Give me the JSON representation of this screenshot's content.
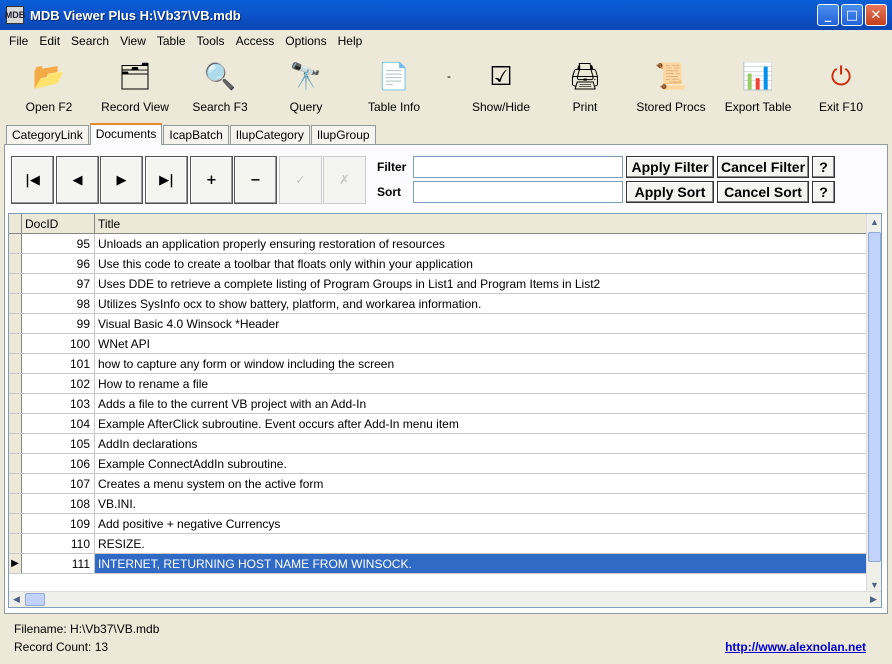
{
  "window": {
    "title": "MDB Viewer Plus H:\\Vb37\\VB.mdb",
    "app_icon_text": "MDB",
    "min_glyph": "_",
    "max_glyph": "□",
    "close_glyph": "✕"
  },
  "menu": [
    "File",
    "Edit",
    "Search",
    "View",
    "Table",
    "Tools",
    "Access",
    "Options",
    "Help"
  ],
  "toolbar": [
    {
      "label": "Open F2",
      "icon": "folder-icon",
      "glyph": "📂"
    },
    {
      "label": "Record View",
      "icon": "record-view-icon",
      "glyph": "🗂"
    },
    {
      "label": "Search F3",
      "icon": "magnifier-icon",
      "glyph": "🔍"
    },
    {
      "label": "Query",
      "icon": "binoculars-icon",
      "glyph": "🔭"
    },
    {
      "label": "Table Info",
      "icon": "table-info-icon",
      "glyph": "📄"
    },
    {
      "label": "-",
      "icon": "separator",
      "glyph": ""
    },
    {
      "label": "Show/Hide",
      "icon": "show-hide-icon",
      "glyph": "☑"
    },
    {
      "label": "Print",
      "icon": "printer-icon",
      "glyph": "🖨"
    },
    {
      "label": "Stored Procs",
      "icon": "stored-procs-icon",
      "glyph": "📜"
    },
    {
      "label": "Export Table",
      "icon": "export-table-icon",
      "glyph": "📊"
    },
    {
      "label": "Exit F10",
      "icon": "exit-icon",
      "glyph": "⏻"
    }
  ],
  "tabs": [
    {
      "label": "CategoryLink",
      "active": false
    },
    {
      "label": "Documents",
      "active": true
    },
    {
      "label": "IcapBatch",
      "active": false
    },
    {
      "label": "IlupCategory",
      "active": false
    },
    {
      "label": "IlupGroup",
      "active": false
    }
  ],
  "nav": {
    "first": "|◀",
    "prev": "◀",
    "next": "▶",
    "last": "▶|",
    "add": "+",
    "remove": "−",
    "confirm": "✓",
    "cancel": "✗"
  },
  "filter": {
    "filter_label": "Filter",
    "sort_label": "Sort",
    "filter_value": "",
    "sort_value": "",
    "apply_filter": "Apply Filter",
    "cancel_filter": "Cancel Filter",
    "apply_sort": "Apply Sort",
    "cancel_sort": "Cancel Sort",
    "help": "?"
  },
  "grid": {
    "columns": [
      "DocID",
      "Title"
    ],
    "current_row_marker": "▶",
    "rows": [
      {
        "id": "95",
        "title": "Unloads an application properly ensuring restoration of resources"
      },
      {
        "id": "96",
        "title": "Use this code to create a toolbar that floats only within your application"
      },
      {
        "id": "97",
        "title": "Uses DDE to retrieve a complete listing of Program Groups in List1 and Program Items in List2"
      },
      {
        "id": "98",
        "title": "Utilizes SysInfo ocx to show battery, platform, and workarea information."
      },
      {
        "id": "99",
        "title": "Visual Basic 4.0 Winsock *Header"
      },
      {
        "id": "100",
        "title": "WNet API"
      },
      {
        "id": "101",
        "title": "how to capture any form or window including the screen"
      },
      {
        "id": "102",
        "title": "How to rename a file"
      },
      {
        "id": "103",
        "title": "Adds a file to the current VB project with an Add-In"
      },
      {
        "id": "104",
        "title": "Example AfterClick subroutine. Event occurs after Add-In menu item"
      },
      {
        "id": "105",
        "title": "AddIn declarations"
      },
      {
        "id": "106",
        "title": "Example ConnectAddIn subroutine."
      },
      {
        "id": "107",
        "title": "Creates a menu system on the active form"
      },
      {
        "id": "108",
        "title": "VB.INI."
      },
      {
        "id": "109",
        "title": "Add positive + negative Currencys"
      },
      {
        "id": "110",
        "title": "RESIZE."
      },
      {
        "id": "111",
        "title": "INTERNET, RETURNING HOST NAME FROM WINSOCK."
      }
    ],
    "current_index": 16
  },
  "status": {
    "filename": "Filename: H:\\Vb37\\VB.mdb",
    "record_count": "Record Count: 13",
    "link": "http://www.alexnolan.net"
  }
}
